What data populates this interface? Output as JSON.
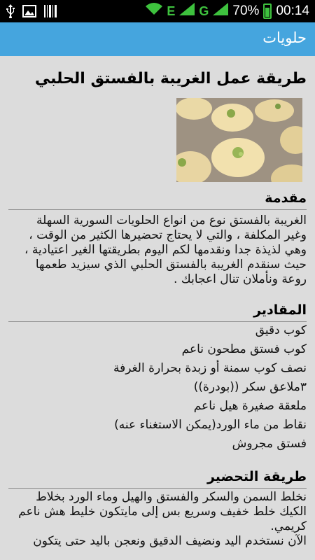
{
  "status_bar": {
    "battery_percent": "70%",
    "network_letters": [
      "E",
      "G"
    ],
    "time": "00:14",
    "icons": [
      "usb-icon",
      "image-icon",
      "barcode-icon",
      "wifi-icon",
      "signal-icon",
      "signal-icon",
      "battery-icon"
    ]
  },
  "app_bar": {
    "title": "حلويات"
  },
  "article": {
    "title": "طريقة عمل الغريبة بالفستق الحلبي",
    "intro_heading": "مقدمة",
    "intro_lines": [
      "الغريبة بالفستق نوع من انواع الحلويات السورية السهلة",
      "وغير المكلفة ، والتي لا يحتاج تحضيرها الكثير من الوقت ،",
      "وهي لذيذة جدا ونقدمها لكم اليوم بطريقتها الغير اعتيادية ،",
      "حيث سنقدم الغريبة بالفستق الحلبي الذي سيزيد طعمها",
      "روعة ونأملان تنال اعجابك ."
    ],
    "ingredients_heading": "المقادير",
    "ingredients": [
      "كوب دقيق",
      "كوب فستق مطحون ناعم",
      "نصف كوب سمنة أو زبدة بحرارة الغرفة",
      "٣ملاعق سكر ((بودرة))",
      "ملعقة صغيرة هيل ناعم",
      "نقاط من ماء الورد(يمكن الاستغناء عنه)",
      "فستق مجروش"
    ],
    "method_heading": "طريقة التحضير",
    "method_lines": [
      "نخلط السمن والسكر والفستق والهيل وماء الورد بخلاط",
      "الكيك خلط خفيف وسريع بس إلى مايتكون خليط هش ناعم",
      "كريمي.",
      "الآن نستخدم اليد ونضيف الدقيق ونعجن باليد حتى يتكون"
    ]
  }
}
